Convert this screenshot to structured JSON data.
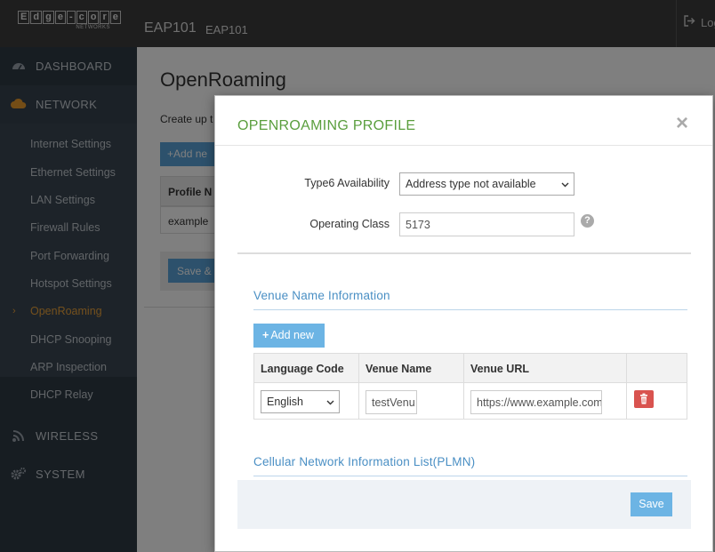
{
  "header": {
    "logo_letters": [
      "E",
      "d",
      "g",
      "e",
      "-",
      "c",
      "o",
      "r",
      "e"
    ],
    "logo_sub": "NETWORKS",
    "device_name": "EAP101",
    "device_model": "EAP101",
    "logout_label": "Log"
  },
  "sidebar": {
    "main": [
      {
        "label": "DASHBOARD",
        "icon": "dashboard-icon"
      },
      {
        "label": "NETWORK",
        "icon": "cloud-icon",
        "active": true
      },
      {
        "label": "WIRELESS",
        "icon": "wifi-icon"
      },
      {
        "label": "SYSTEM",
        "icon": "gears-icon"
      }
    ],
    "network_items": [
      "Internet Settings",
      "Ethernet Settings",
      "LAN Settings",
      "Firewall Rules",
      "Port Forwarding",
      "Hotspot Settings",
      "OpenRoaming",
      "DHCP Snooping",
      "ARP Inspection",
      "DHCP Relay"
    ],
    "active_item": "OpenRoaming"
  },
  "page": {
    "title": "OpenRoaming",
    "description": "Create up t",
    "add_button": "Add ne",
    "table_header": "Profile N",
    "table_row": "example",
    "save_button": "Save &"
  },
  "modal": {
    "title": "OPENROAMING PROFILE",
    "close_symbol": "×",
    "type6_label": "Type6 Availability",
    "type6_value": "Address type not available",
    "opclass_label": "Operating Class",
    "opclass_value": "5173",
    "help_symbol": "?",
    "venue_section_title": "Venue Name Information",
    "add_new_label": "Add new",
    "venue_table": {
      "headers": [
        "Language Code",
        "Venue Name",
        "Venue URL",
        ""
      ],
      "row": {
        "language": "English",
        "venue_name": "testVenu",
        "venue_url": "https://www.example.com"
      }
    },
    "cellular_section_title": "Cellular Network Information List(PLMN)",
    "save_label": "Save"
  },
  "colors": {
    "header_bg": "#3c3c3c",
    "sidebar_bg": "#2f3a45",
    "accent_orange": "#e8a13a",
    "modal_title_green": "#5a9e3d",
    "section_blue": "#4a8fc4",
    "button_blue": "#6cb4e4",
    "delete_red": "#d9534f"
  }
}
